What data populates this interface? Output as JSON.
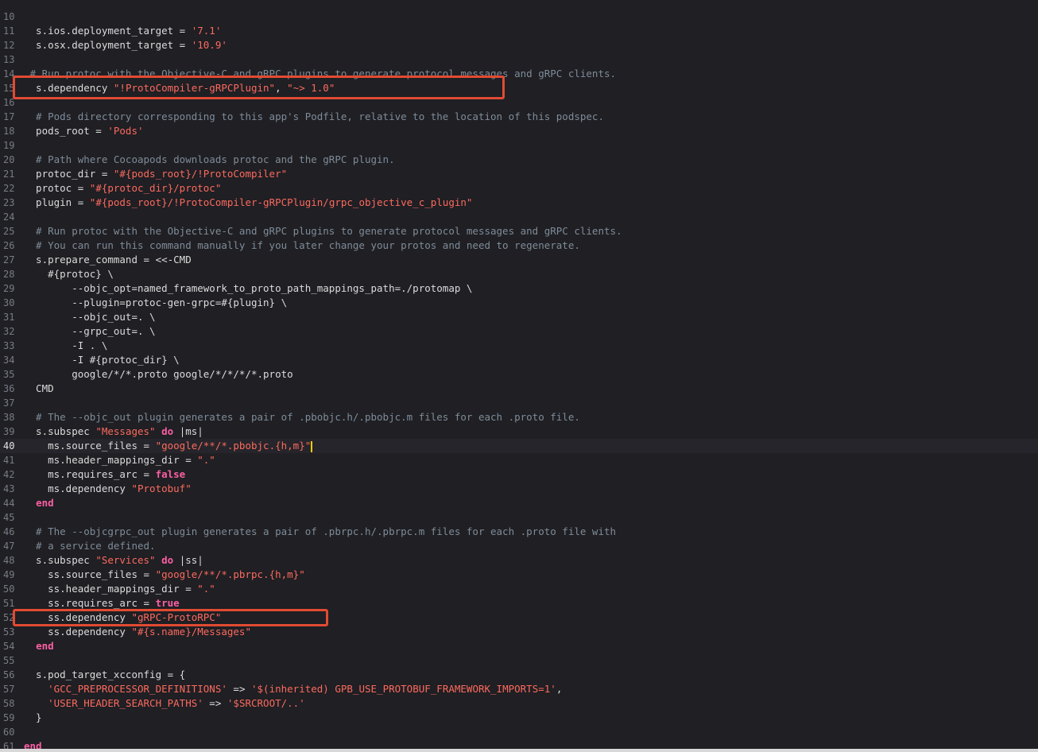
{
  "editor": {
    "current_line": 40,
    "highlight_color": "#e14b32",
    "lines": [
      {
        "n": 10,
        "tokens": []
      },
      {
        "n": 11,
        "tokens": [
          {
            "t": "  s.ios.deployment_target = ",
            "c": "plain"
          },
          {
            "t": "'7.1'",
            "c": "str"
          }
        ]
      },
      {
        "n": 12,
        "tokens": [
          {
            "t": "  s.osx.deployment_target = ",
            "c": "plain"
          },
          {
            "t": "'10.9'",
            "c": "str"
          }
        ]
      },
      {
        "n": 13,
        "tokens": []
      },
      {
        "n": 14,
        "tokens": [
          {
            "t": " # Run protoc with the Objective-C and gRPC plugins to generate protocol messages and gRPC clients.",
            "c": "cm"
          }
        ]
      },
      {
        "n": 15,
        "tokens": [
          {
            "t": "  s.dependency ",
            "c": "plain"
          },
          {
            "t": "\"!ProtoCompiler-gRPCPlugin\"",
            "c": "str"
          },
          {
            "t": ", ",
            "c": "plain"
          },
          {
            "t": "\"~> 1.0\"",
            "c": "str"
          }
        ]
      },
      {
        "n": 16,
        "tokens": []
      },
      {
        "n": 17,
        "tokens": [
          {
            "t": "  # Pods directory corresponding to this app's Podfile, relative to the location of this podspec.",
            "c": "cm"
          }
        ]
      },
      {
        "n": 18,
        "tokens": [
          {
            "t": "  pods_root = ",
            "c": "plain"
          },
          {
            "t": "'Pods'",
            "c": "str"
          }
        ]
      },
      {
        "n": 19,
        "tokens": []
      },
      {
        "n": 20,
        "tokens": [
          {
            "t": "  # Path where Cocoapods downloads protoc and the gRPC plugin.",
            "c": "cm"
          }
        ]
      },
      {
        "n": 21,
        "tokens": [
          {
            "t": "  protoc_dir = ",
            "c": "plain"
          },
          {
            "t": "\"#{pods_root}/!ProtoCompiler\"",
            "c": "str"
          }
        ]
      },
      {
        "n": 22,
        "tokens": [
          {
            "t": "  protoc = ",
            "c": "plain"
          },
          {
            "t": "\"#{protoc_dir}/protoc\"",
            "c": "str"
          }
        ]
      },
      {
        "n": 23,
        "tokens": [
          {
            "t": "  plugin = ",
            "c": "plain"
          },
          {
            "t": "\"#{pods_root}/!ProtoCompiler-gRPCPlugin/grpc_objective_c_plugin\"",
            "c": "str"
          }
        ]
      },
      {
        "n": 24,
        "tokens": []
      },
      {
        "n": 25,
        "tokens": [
          {
            "t": "  # Run protoc with the Objective-C and gRPC plugins to generate protocol messages and gRPC clients.",
            "c": "cm"
          }
        ]
      },
      {
        "n": 26,
        "tokens": [
          {
            "t": "  # You can run this command manually if you later change your protos and need to regenerate.",
            "c": "cm"
          }
        ]
      },
      {
        "n": 27,
        "tokens": [
          {
            "t": "  s.prepare_command = <<-CMD",
            "c": "plain"
          }
        ]
      },
      {
        "n": 28,
        "tokens": [
          {
            "t": "    #{protoc} \\",
            "c": "plain"
          }
        ]
      },
      {
        "n": 29,
        "tokens": [
          {
            "t": "        --objc_opt=named_framework_to_proto_path_mappings_path=./protomap \\",
            "c": "plain"
          }
        ]
      },
      {
        "n": 30,
        "tokens": [
          {
            "t": "        --plugin=protoc-gen-grpc=#{plugin} \\",
            "c": "plain"
          }
        ]
      },
      {
        "n": 31,
        "tokens": [
          {
            "t": "        --objc_out=. \\",
            "c": "plain"
          }
        ]
      },
      {
        "n": 32,
        "tokens": [
          {
            "t": "        --grpc_out=. \\",
            "c": "plain"
          }
        ]
      },
      {
        "n": 33,
        "tokens": [
          {
            "t": "        -I . \\",
            "c": "plain"
          }
        ]
      },
      {
        "n": 34,
        "tokens": [
          {
            "t": "        -I #{protoc_dir} \\",
            "c": "plain"
          }
        ]
      },
      {
        "n": 35,
        "tokens": [
          {
            "t": "        google/*/*.proto google/*/*/*/*.proto",
            "c": "plain"
          }
        ]
      },
      {
        "n": 36,
        "tokens": [
          {
            "t": "  CMD",
            "c": "plain"
          }
        ]
      },
      {
        "n": 37,
        "tokens": []
      },
      {
        "n": 38,
        "tokens": [
          {
            "t": "  # The --objc_out plugin generates a pair of .pbobjc.h/.pbobjc.m files for each .proto file.",
            "c": "cm"
          }
        ]
      },
      {
        "n": 39,
        "tokens": [
          {
            "t": "  s.subspec ",
            "c": "plain"
          },
          {
            "t": "\"Messages\"",
            "c": "str"
          },
          {
            "t": " ",
            "c": "plain"
          },
          {
            "t": "do",
            "c": "kw"
          },
          {
            "t": " |ms|",
            "c": "plain"
          }
        ]
      },
      {
        "n": 40,
        "tokens": [
          {
            "t": "    ms.source_files = ",
            "c": "plain"
          },
          {
            "t": "\"google/**/*.pbobjc.{h,m}\"",
            "c": "str"
          }
        ],
        "caret": true
      },
      {
        "n": 41,
        "tokens": [
          {
            "t": "    ms.header_mappings_dir = ",
            "c": "plain"
          },
          {
            "t": "\".\"",
            "c": "str"
          }
        ]
      },
      {
        "n": 42,
        "tokens": [
          {
            "t": "    ms.requires_arc = ",
            "c": "plain"
          },
          {
            "t": "false",
            "c": "kw"
          }
        ]
      },
      {
        "n": 43,
        "tokens": [
          {
            "t": "    ms.dependency ",
            "c": "plain"
          },
          {
            "t": "\"Protobuf\"",
            "c": "str"
          }
        ]
      },
      {
        "n": 44,
        "tokens": [
          {
            "t": "  ",
            "c": "plain"
          },
          {
            "t": "end",
            "c": "kw"
          }
        ]
      },
      {
        "n": 45,
        "tokens": []
      },
      {
        "n": 46,
        "tokens": [
          {
            "t": "  # The --objcgrpc_out plugin generates a pair of .pbrpc.h/.pbrpc.m files for each .proto file with",
            "c": "cm"
          }
        ]
      },
      {
        "n": 47,
        "tokens": [
          {
            "t": "  # a service defined.",
            "c": "cm"
          }
        ]
      },
      {
        "n": 48,
        "tokens": [
          {
            "t": "  s.subspec ",
            "c": "plain"
          },
          {
            "t": "\"Services\"",
            "c": "str"
          },
          {
            "t": " ",
            "c": "plain"
          },
          {
            "t": "do",
            "c": "kw"
          },
          {
            "t": " |ss|",
            "c": "plain"
          }
        ]
      },
      {
        "n": 49,
        "tokens": [
          {
            "t": "    ss.source_files = ",
            "c": "plain"
          },
          {
            "t": "\"google/**/*.pbrpc.{h,m}\"",
            "c": "str"
          }
        ]
      },
      {
        "n": 50,
        "tokens": [
          {
            "t": "    ss.header_mappings_dir = ",
            "c": "plain"
          },
          {
            "t": "\".\"",
            "c": "str"
          }
        ]
      },
      {
        "n": 51,
        "tokens": [
          {
            "t": "    ss.requires_arc = ",
            "c": "plain"
          },
          {
            "t": "true",
            "c": "kw"
          }
        ]
      },
      {
        "n": 52,
        "tokens": [
          {
            "t": "    ss.dependency ",
            "c": "plain"
          },
          {
            "t": "\"gRPC-ProtoRPC\"",
            "c": "str"
          }
        ]
      },
      {
        "n": 53,
        "tokens": [
          {
            "t": "    ss.dependency ",
            "c": "plain"
          },
          {
            "t": "\"#{s.name}/Messages\"",
            "c": "str"
          }
        ]
      },
      {
        "n": 54,
        "tokens": [
          {
            "t": "  ",
            "c": "plain"
          },
          {
            "t": "end",
            "c": "kw"
          }
        ]
      },
      {
        "n": 55,
        "tokens": []
      },
      {
        "n": 56,
        "tokens": [
          {
            "t": "  s.pod_target_xcconfig = {",
            "c": "plain"
          }
        ]
      },
      {
        "n": 57,
        "tokens": [
          {
            "t": "    ",
            "c": "plain"
          },
          {
            "t": "'GCC_PREPROCESSOR_DEFINITIONS'",
            "c": "str"
          },
          {
            "t": " => ",
            "c": "plain"
          },
          {
            "t": "'$(inherited) GPB_USE_PROTOBUF_FRAMEWORK_IMPORTS=1'",
            "c": "str"
          },
          {
            "t": ",",
            "c": "plain"
          }
        ]
      },
      {
        "n": 58,
        "tokens": [
          {
            "t": "    ",
            "c": "plain"
          },
          {
            "t": "'USER_HEADER_SEARCH_PATHS'",
            "c": "str"
          },
          {
            "t": " => ",
            "c": "plain"
          },
          {
            "t": "'$SRCROOT/..'",
            "c": "str"
          }
        ]
      },
      {
        "n": 59,
        "tokens": [
          {
            "t": "  }",
            "c": "plain"
          }
        ]
      },
      {
        "n": 60,
        "tokens": []
      },
      {
        "n": 61,
        "tokens": [
          {
            "t": "end",
            "c": "kw"
          }
        ]
      }
    ]
  }
}
